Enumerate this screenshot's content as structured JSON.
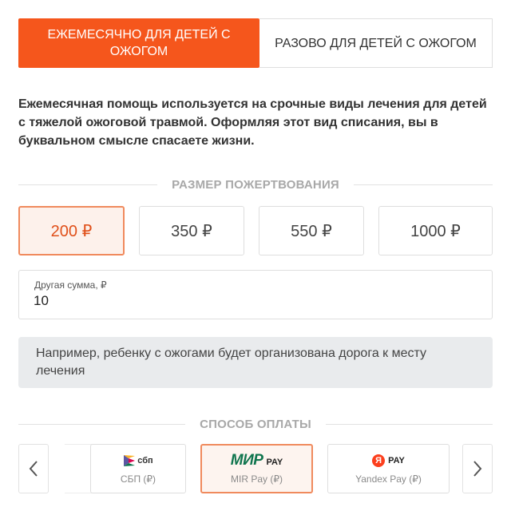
{
  "tabs": {
    "monthly": "ЕЖЕМЕСЯЧНО ДЛЯ ДЕТЕЙ С ОЖОГОМ",
    "once": "РАЗОВО ДЛЯ ДЕТЕЙ С ОЖОГОМ"
  },
  "description": "Ежемесячная помощь используется на срочные виды лечения для детей с тяжелой ожоговой травмой. Оформляя этот вид списания, вы в буквальном смысле спасаете жизни.",
  "donation": {
    "title": "РАЗМЕР ПОЖЕРТВОВАНИЯ",
    "amounts": [
      "200 ₽",
      "350 ₽",
      "550 ₽",
      "1000 ₽"
    ],
    "selected": "200 ₽",
    "other_label": "Другая сумма, ₽",
    "other_value": "10"
  },
  "hint": "Например, ребенку с ожогами будет организована дорога к месту лечения",
  "payment": {
    "title": "СПОСОБ ОПЛАТЫ",
    "methods": [
      {
        "name": "СБП (₽)",
        "logo_text": "сбп",
        "icon": "sbp-logo-icon"
      },
      {
        "name": "MIR Pay (₽)",
        "logo_text": "МИР",
        "logo_suffix": "PAY",
        "icon": "mir-pay-logo-icon"
      },
      {
        "name": "Yandex Pay (₽)",
        "logo_text": "Я",
        "logo_suffix": "PAY",
        "icon": "yandex-pay-logo-icon"
      }
    ],
    "selected": "MIR Pay (₽)"
  },
  "colors": {
    "accent": "#f5561c",
    "selected_border": "#f08a5d",
    "selected_bg": "#fdf1eb",
    "hint_bg": "#e9ebed",
    "mir_green": "#0f754e",
    "yandex_red": "#fc3f1d"
  }
}
